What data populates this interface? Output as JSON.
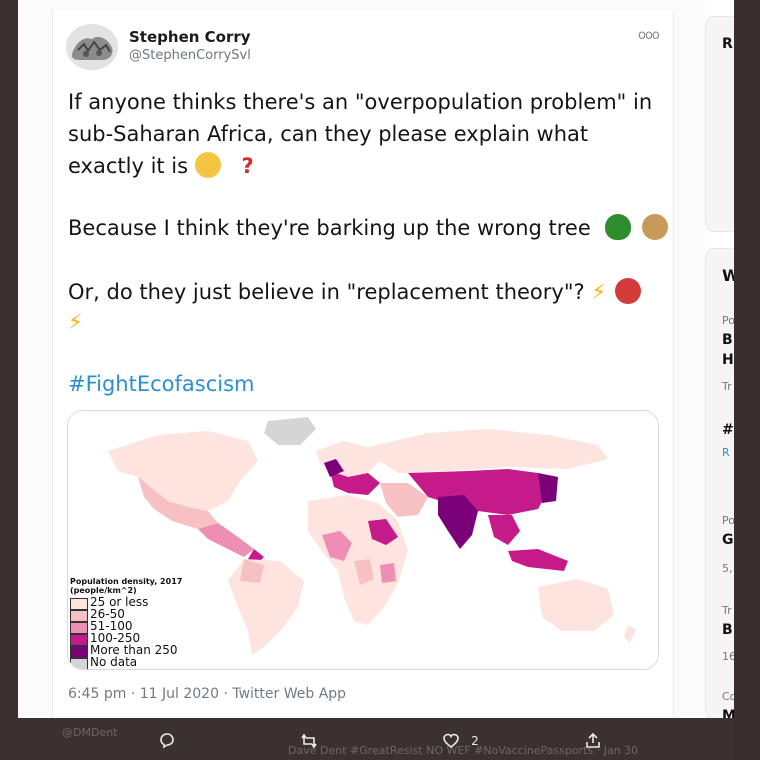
{
  "tweet": {
    "author_name": "Stephen Corry",
    "author_handle": "@StephenCorrySvl",
    "more_label": "ooo",
    "lines": [
      "If anyone thinks there's an \"overpopulation problem\" in",
      "sub-Saharan Africa, can they please explain what",
      "exactly it is",
      "Because I think they're barking up the wrong tree",
      "Or, do they just believe in \"replacement theory\"?"
    ],
    "question_mark": "?",
    "bolt": "⚡",
    "hashtag": "#FightEcofascism",
    "timestamp": "6:45 pm · 11 Jul 2020 · Twitter Web App"
  },
  "map": {
    "legend_title": "Population density, 2017",
    "legend_subtitle": "(people/km^2)",
    "legend": [
      {
        "label": "25 or less",
        "color": "#fde4df"
      },
      {
        "label": "26-50",
        "color": "#f7c1c4"
      },
      {
        "label": "51-100",
        "color": "#ef8eb4"
      },
      {
        "label": "100-250",
        "color": "#c51b8a"
      },
      {
        "label": "More than 250",
        "color": "#7a0177"
      },
      {
        "label": "No data",
        "color": "#d5d5d5"
      }
    ]
  },
  "actions": {
    "reply_icon": "reply-icon",
    "retweet_icon": "retweet-icon",
    "like_icon": "like-icon",
    "like_count": "2",
    "share_icon": "share-icon"
  },
  "background_text": {
    "reply_handle": "@DMDent",
    "reply_line": "Dave Dent #GreatResist NO WEF #NoVaccinePassports · Jan 30"
  },
  "right_panel": {
    "items": [
      "R",
      "W",
      "Po",
      "B",
      "H",
      "Tr",
      "#",
      "R",
      "Po",
      "G",
      "5,",
      "Tr",
      "B",
      "16",
      "Co",
      "M"
    ]
  }
}
